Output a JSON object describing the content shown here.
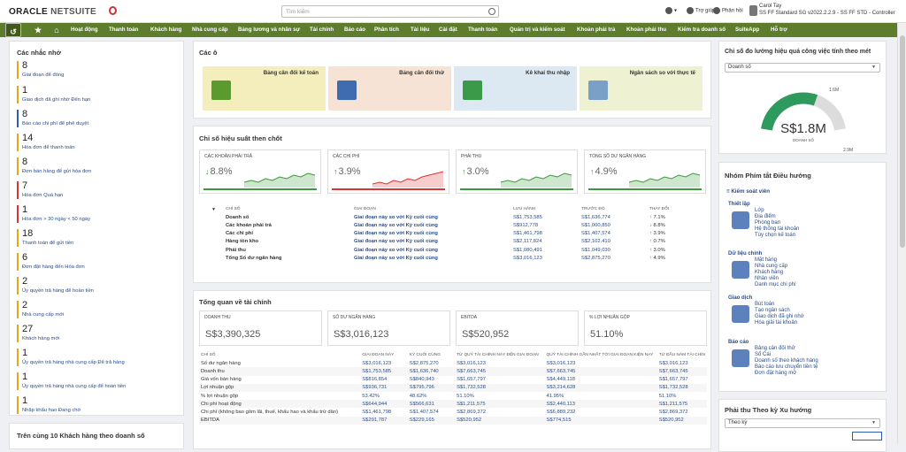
{
  "header": {
    "logo_a": "ORACLE",
    "logo_b": "NETSUITE",
    "search_placeholder": "Tìm kiếm",
    "help": "Trợ giúp",
    "feedback": "Phản hồi",
    "user_name": "Carol Tay",
    "user_role": "SS FF Standard SG v2022.2.2.9 - SS FF STD - Controller"
  },
  "nav": [
    "Hoạt động",
    "Thanh toán",
    "Khách hàng",
    "Nhà cung cấp",
    "Bảng lương và nhân sự",
    "Tài chính",
    "Báo cáo",
    "Phân tích",
    "Tài liệu",
    "Cài đặt",
    "Thanh toán",
    "Quản trị và kiểm soát",
    "Khoản phải trả",
    "Khoản phải thu",
    "Kiểm tra doanh số",
    "SuiteApp",
    "Hỗ trợ"
  ],
  "reminders": {
    "title": "Các nhắc nhở",
    "items": [
      {
        "n": "8",
        "t": "Giai đoạn để đóng"
      },
      {
        "n": "1",
        "t": "Giao dịch đã ghi nhớ Đến hạn"
      },
      {
        "n": "8",
        "t": "Báo cáo chi phí để phê duyệt"
      },
      {
        "n": "14",
        "t": "Hóa đơn để thanh toán"
      },
      {
        "n": "8",
        "t": "Đơn bán hàng để gửi hóa đơn"
      },
      {
        "n": "7",
        "t": "Hóa đơn Quá hạn"
      },
      {
        "n": "1",
        "t": "Hóa đơn > 30 ngày < 50 ngày"
      },
      {
        "n": "18",
        "t": "Thanh toán để gửi tiền"
      },
      {
        "n": "6",
        "t": "Đơn đặt hàng đến Hóa đơn"
      },
      {
        "n": "2",
        "t": "Ủy quyền trả hàng để hoàn tiền"
      },
      {
        "n": "2",
        "t": "Nhà cung cấp mới"
      },
      {
        "n": "27",
        "t": "Khách hàng mới"
      },
      {
        "n": "1",
        "t": "Ủy quyền trả hàng nhà cung cấp Để trả hàng"
      },
      {
        "n": "1",
        "t": "Ủy quyền trả hàng nhà cung cấp để hoàn tiền"
      },
      {
        "n": "1",
        "t": "Nhập khẩu hao Đang chờ"
      }
    ]
  },
  "top10_title": "Trên cùng 10 Khách hàng theo doanh số",
  "tiles": {
    "title": "Các ô",
    "items": [
      {
        "label": "Bảng cân đối kế toán",
        "bg": "#f4eebc"
      },
      {
        "label": "Bảng cân đối thử",
        "bg": "#f6e3d5"
      },
      {
        "label": "Kê khai thu nhập",
        "bg": "#dce9f3"
      },
      {
        "label": "Ngân sách so với thực tế",
        "bg": "#eef2d3"
      }
    ]
  },
  "kpi": {
    "title": "Chỉ số hiệu suất then chốt",
    "cards": [
      {
        "label": "CÁC KHOẢN PHẢI TRẢ",
        "value": "8.8%",
        "dir": "down"
      },
      {
        "label": "CÁC CHI PHÍ",
        "value": "3.9%",
        "dir": "up"
      },
      {
        "label": "PHẢI THU",
        "value": "3.0%",
        "dir": "up"
      },
      {
        "label": "TỔNG SỐ DƯ NGÂN HÀNG",
        "value": "4.9%",
        "dir": "up"
      }
    ],
    "headers": [
      "CHỈ SỐ",
      "GIAI ĐOẠN",
      "LƯU HÀNH",
      "TRƯỚC ĐÓ",
      "THAY ĐỔI"
    ],
    "rows": [
      [
        "Doanh số",
        "Giai đoạn này so với Kỳ cuối cùng",
        "S$1,753,585",
        "S$1,636,774",
        "7.1%",
        "up"
      ],
      [
        "Các khoản phải trả",
        "Giai đoạn này so với Kỳ cuối cùng",
        "S$912,778",
        "S$1,000,850",
        "8.8%",
        "down"
      ],
      [
        "Các chi phí",
        "Giai đoạn này so với Kỳ cuối cùng",
        "S$1,461,798",
        "S$1,407,574",
        "3.9%",
        "up"
      ],
      [
        "Hàng tồn kho",
        "Giai đoạn này so với Kỳ cuối cùng",
        "S$2,117,824",
        "S$2,102,410",
        "0.7%",
        "up"
      ],
      [
        "Phải thu",
        "Giai đoạn này so với Kỳ cuối cùng",
        "S$1,080,491",
        "S$1,049,030",
        "3.0%",
        "up"
      ],
      [
        "Tổng Số dư ngân hàng",
        "Giai đoạn này so với Kỳ cuối cùng",
        "S$3,016,123",
        "S$2,875,270",
        "4.9%",
        "up"
      ]
    ]
  },
  "fin": {
    "title": "Tổng quan về tài chính",
    "cards": [
      {
        "label": "DOANH THU",
        "value": "S$3,390,325"
      },
      {
        "label": "SỐ DƯ NGÂN HÀNG",
        "value": "S$3,016,123"
      },
      {
        "label": "EBITDA",
        "value": "S$520,952"
      },
      {
        "label": "% LỢI NHUẬN GỘP",
        "value": "51.10%"
      }
    ],
    "headers": [
      "CHỈ SỐ",
      "GIAI ĐOẠN NÀY",
      "KỲ CUỐI CÙNG",
      "TỪ QUÝ TÀI CHÍNH NÀY ĐẾN GIAI ĐOẠN",
      "QUÝ TÀI CHÍNH GẦN NHẤT TỚI GIAI ĐOẠN KIỆN NAY",
      "TỪ ĐẦU NĂM TÀI CHÍN"
    ],
    "rows": [
      [
        "Số dư ngân hàng",
        "S$3,016,123",
        "S$2,875,270",
        "S$3,016,123",
        "S$3,016,123",
        "S$3,016,123"
      ],
      [
        "Doanh thu",
        "S$1,753,585",
        "S$1,636,740",
        "S$7,663,745",
        "S$7,663,745",
        "S$7,663,745"
      ],
      [
        "Giá vốn bán hàng",
        "S$816,854",
        "S$840,943",
        "S$1,657,797",
        "S$4,449,118",
        "S$1,657,797"
      ],
      [
        "Lợi nhuận gộp",
        "S$936,731",
        "S$795,796",
        "S$1,732,528",
        "S$3,214,628",
        "S$1,732,528"
      ],
      [
        "% lợi nhuận gộp",
        "53.42%",
        "48.62%",
        "51.10%",
        "41.95%",
        "51.10%"
      ],
      [
        "Chi phí hoạt động",
        "S$644,944",
        "S$566,631",
        "S$1,211,575",
        "S$2,440,113",
        "S$1,211,575"
      ],
      [
        "Chi phí (không bao gồm lãi, thuế, khấu hao và khấu trừ dần)",
        "S$1,461,798",
        "S$1,407,574",
        "S$2,869,372",
        "S$6,889,232",
        "S$2,869,372"
      ],
      [
        "EBITDA",
        "S$291,787",
        "S$229,165",
        "S$520,952",
        "S$774,515",
        "S$520,952"
      ]
    ]
  },
  "gauge": {
    "title": "Chỉ số đo lường hiệu quả công việc tính theo mét",
    "select": "Doanh số",
    "value": "S$1.8M",
    "label": "DOANH SỐ",
    "mark_a": "1.6M",
    "mark_b": "2.9M",
    "fill": 0.62
  },
  "shortcuts": {
    "title": "Nhóm Phím tắt Điều hướng",
    "sub": "Kiểm soát viên",
    "groups": [
      {
        "h": "Thiết lập",
        "items": [
          "Lớp",
          "Địa điểm",
          "Phòng ban",
          "Hệ thống tài khoản",
          "Tùy chọn kế toán"
        ]
      },
      {
        "h": "Dữ liệu chính",
        "items": [
          "Mặt hàng",
          "Nhà cung cấp",
          "Khách hàng",
          "Nhân viên",
          "Danh mục chi phí"
        ]
      },
      {
        "h": "Giao dịch",
        "items": [
          "Bút toán",
          "Tạo ngân sách",
          "Giao dịch đã ghi nhớ",
          "Hóa giải tài khoản"
        ]
      },
      {
        "h": "Báo cáo",
        "items": [
          "Bảng cân đối thử",
          "Sổ Cái",
          "Doanh số theo khách hàng",
          "Báo cáo lưu chuyển tiền tệ",
          "Đơn đặt hàng mở"
        ]
      }
    ]
  },
  "trend": {
    "title": "Phải thu Theo kỳ Xu hướng",
    "select": "Theo kỳ"
  },
  "colors": {
    "nav": "#5d7d2c",
    "gauge": "#2e9a5e",
    "up": "#3a9a3a",
    "down": "#d33"
  }
}
